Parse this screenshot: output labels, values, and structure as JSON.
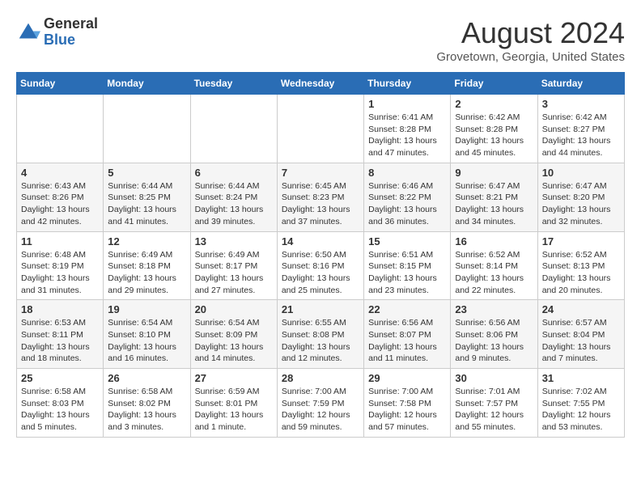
{
  "logo": {
    "general": "General",
    "blue": "Blue"
  },
  "title": "August 2024",
  "location": "Grovetown, Georgia, United States",
  "weekdays": [
    "Sunday",
    "Monday",
    "Tuesday",
    "Wednesday",
    "Thursday",
    "Friday",
    "Saturday"
  ],
  "weeks": [
    [
      {
        "day": "",
        "sunrise": "",
        "sunset": "",
        "daylight": ""
      },
      {
        "day": "",
        "sunrise": "",
        "sunset": "",
        "daylight": ""
      },
      {
        "day": "",
        "sunrise": "",
        "sunset": "",
        "daylight": ""
      },
      {
        "day": "",
        "sunrise": "",
        "sunset": "",
        "daylight": ""
      },
      {
        "day": "1",
        "sunrise": "Sunrise: 6:41 AM",
        "sunset": "Sunset: 8:28 PM",
        "daylight": "Daylight: 13 hours and 47 minutes."
      },
      {
        "day": "2",
        "sunrise": "Sunrise: 6:42 AM",
        "sunset": "Sunset: 8:28 PM",
        "daylight": "Daylight: 13 hours and 45 minutes."
      },
      {
        "day": "3",
        "sunrise": "Sunrise: 6:42 AM",
        "sunset": "Sunset: 8:27 PM",
        "daylight": "Daylight: 13 hours and 44 minutes."
      }
    ],
    [
      {
        "day": "4",
        "sunrise": "Sunrise: 6:43 AM",
        "sunset": "Sunset: 8:26 PM",
        "daylight": "Daylight: 13 hours and 42 minutes."
      },
      {
        "day": "5",
        "sunrise": "Sunrise: 6:44 AM",
        "sunset": "Sunset: 8:25 PM",
        "daylight": "Daylight: 13 hours and 41 minutes."
      },
      {
        "day": "6",
        "sunrise": "Sunrise: 6:44 AM",
        "sunset": "Sunset: 8:24 PM",
        "daylight": "Daylight: 13 hours and 39 minutes."
      },
      {
        "day": "7",
        "sunrise": "Sunrise: 6:45 AM",
        "sunset": "Sunset: 8:23 PM",
        "daylight": "Daylight: 13 hours and 37 minutes."
      },
      {
        "day": "8",
        "sunrise": "Sunrise: 6:46 AM",
        "sunset": "Sunset: 8:22 PM",
        "daylight": "Daylight: 13 hours and 36 minutes."
      },
      {
        "day": "9",
        "sunrise": "Sunrise: 6:47 AM",
        "sunset": "Sunset: 8:21 PM",
        "daylight": "Daylight: 13 hours and 34 minutes."
      },
      {
        "day": "10",
        "sunrise": "Sunrise: 6:47 AM",
        "sunset": "Sunset: 8:20 PM",
        "daylight": "Daylight: 13 hours and 32 minutes."
      }
    ],
    [
      {
        "day": "11",
        "sunrise": "Sunrise: 6:48 AM",
        "sunset": "Sunset: 8:19 PM",
        "daylight": "Daylight: 13 hours and 31 minutes."
      },
      {
        "day": "12",
        "sunrise": "Sunrise: 6:49 AM",
        "sunset": "Sunset: 8:18 PM",
        "daylight": "Daylight: 13 hours and 29 minutes."
      },
      {
        "day": "13",
        "sunrise": "Sunrise: 6:49 AM",
        "sunset": "Sunset: 8:17 PM",
        "daylight": "Daylight: 13 hours and 27 minutes."
      },
      {
        "day": "14",
        "sunrise": "Sunrise: 6:50 AM",
        "sunset": "Sunset: 8:16 PM",
        "daylight": "Daylight: 13 hours and 25 minutes."
      },
      {
        "day": "15",
        "sunrise": "Sunrise: 6:51 AM",
        "sunset": "Sunset: 8:15 PM",
        "daylight": "Daylight: 13 hours and 23 minutes."
      },
      {
        "day": "16",
        "sunrise": "Sunrise: 6:52 AM",
        "sunset": "Sunset: 8:14 PM",
        "daylight": "Daylight: 13 hours and 22 minutes."
      },
      {
        "day": "17",
        "sunrise": "Sunrise: 6:52 AM",
        "sunset": "Sunset: 8:13 PM",
        "daylight": "Daylight: 13 hours and 20 minutes."
      }
    ],
    [
      {
        "day": "18",
        "sunrise": "Sunrise: 6:53 AM",
        "sunset": "Sunset: 8:11 PM",
        "daylight": "Daylight: 13 hours and 18 minutes."
      },
      {
        "day": "19",
        "sunrise": "Sunrise: 6:54 AM",
        "sunset": "Sunset: 8:10 PM",
        "daylight": "Daylight: 13 hours and 16 minutes."
      },
      {
        "day": "20",
        "sunrise": "Sunrise: 6:54 AM",
        "sunset": "Sunset: 8:09 PM",
        "daylight": "Daylight: 13 hours and 14 minutes."
      },
      {
        "day": "21",
        "sunrise": "Sunrise: 6:55 AM",
        "sunset": "Sunset: 8:08 PM",
        "daylight": "Daylight: 13 hours and 12 minutes."
      },
      {
        "day": "22",
        "sunrise": "Sunrise: 6:56 AM",
        "sunset": "Sunset: 8:07 PM",
        "daylight": "Daylight: 13 hours and 11 minutes."
      },
      {
        "day": "23",
        "sunrise": "Sunrise: 6:56 AM",
        "sunset": "Sunset: 8:06 PM",
        "daylight": "Daylight: 13 hours and 9 minutes."
      },
      {
        "day": "24",
        "sunrise": "Sunrise: 6:57 AM",
        "sunset": "Sunset: 8:04 PM",
        "daylight": "Daylight: 13 hours and 7 minutes."
      }
    ],
    [
      {
        "day": "25",
        "sunrise": "Sunrise: 6:58 AM",
        "sunset": "Sunset: 8:03 PM",
        "daylight": "Daylight: 13 hours and 5 minutes."
      },
      {
        "day": "26",
        "sunrise": "Sunrise: 6:58 AM",
        "sunset": "Sunset: 8:02 PM",
        "daylight": "Daylight: 13 hours and 3 minutes."
      },
      {
        "day": "27",
        "sunrise": "Sunrise: 6:59 AM",
        "sunset": "Sunset: 8:01 PM",
        "daylight": "Daylight: 13 hours and 1 minute."
      },
      {
        "day": "28",
        "sunrise": "Sunrise: 7:00 AM",
        "sunset": "Sunset: 7:59 PM",
        "daylight": "Daylight: 12 hours and 59 minutes."
      },
      {
        "day": "29",
        "sunrise": "Sunrise: 7:00 AM",
        "sunset": "Sunset: 7:58 PM",
        "daylight": "Daylight: 12 hours and 57 minutes."
      },
      {
        "day": "30",
        "sunrise": "Sunrise: 7:01 AM",
        "sunset": "Sunset: 7:57 PM",
        "daylight": "Daylight: 12 hours and 55 minutes."
      },
      {
        "day": "31",
        "sunrise": "Sunrise: 7:02 AM",
        "sunset": "Sunset: 7:55 PM",
        "daylight": "Daylight: 12 hours and 53 minutes."
      }
    ]
  ]
}
